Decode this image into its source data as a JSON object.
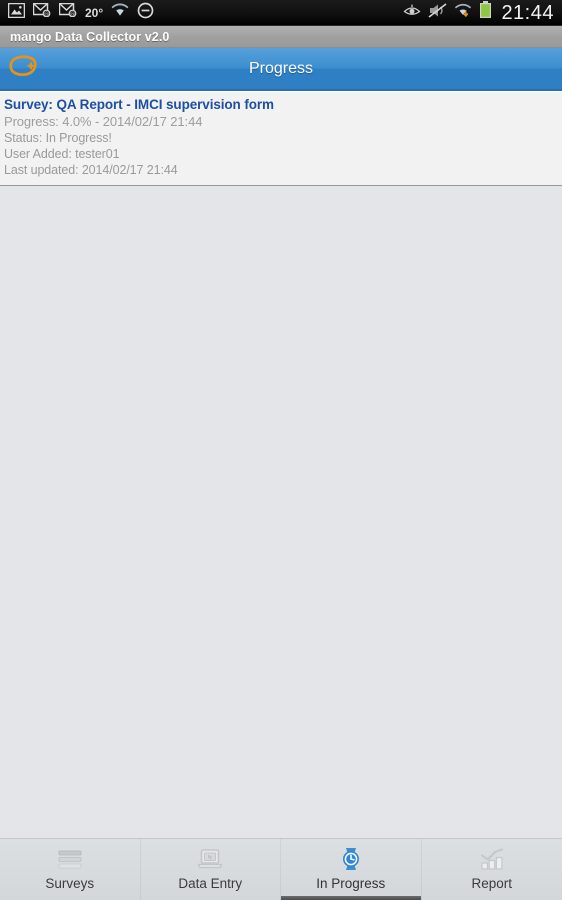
{
  "statusbar": {
    "temperature": "20°",
    "clock": "21:44",
    "left_icons": [
      "gallery-image-icon",
      "email-at-icon",
      "email-at-icon-2",
      "wifi-icon",
      "do-not-disturb-icon"
    ],
    "right_icons": [
      "smart-stay-eye-icon",
      "sound-muted-icon",
      "wifi-download-icon",
      "battery-full-icon"
    ]
  },
  "appbar": {
    "title": "mango Data Collector v2.0"
  },
  "actionbar": {
    "title": "Progress",
    "logo_name": "mango-logo-icon",
    "logo_color": "#e2921f",
    "background_color": "#3d8ed0"
  },
  "list": {
    "items": [
      {
        "title": "Survey: QA Report - IMCI supervision form",
        "progress": "Progress: 4.0% - 2014/02/17 21:44",
        "status": "Status: In Progress!",
        "user_added": "User Added: tester01",
        "last_updated": "Last updated: 2014/02/17 21:44",
        "title_color": "#1f4fa3",
        "sub_color": "#9a9a9a"
      }
    ]
  },
  "tabs": [
    {
      "label": "Surveys",
      "icon": "list-lines-icon",
      "active": false
    },
    {
      "label": "Data Entry",
      "icon": "laptop-icon",
      "active": false
    },
    {
      "label": "In Progress",
      "icon": "watch-clock-icon",
      "active": true
    },
    {
      "label": "Report",
      "icon": "bar-chart-icon",
      "active": false
    }
  ],
  "theme": {
    "accent_blue": "#2f7fc4",
    "active_tab_blue": "#2f86d4",
    "page_background": "#e3e5e8",
    "list_background": "#f2f2f2"
  }
}
